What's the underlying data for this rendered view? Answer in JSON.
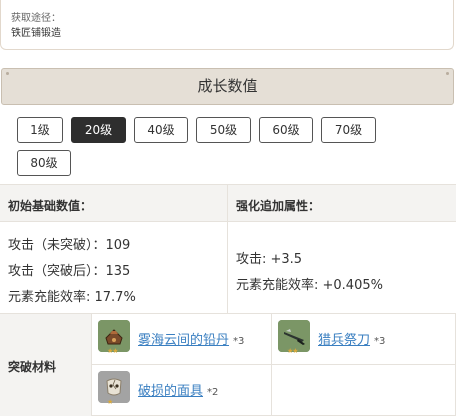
{
  "source": {
    "label": "获取途径：",
    "value": "铁匠铺锻造"
  },
  "growth": {
    "title": "成长数值",
    "levels": [
      "1级",
      "20级",
      "40级",
      "50级",
      "60级",
      "70级",
      "80级"
    ],
    "selected": "20级"
  },
  "stats": {
    "base_header": "初始基础数值：",
    "bonus_header": "强化追加属性：",
    "base": [
      "攻击（未突破）：109",
      "攻击（突破后）：135",
      "元素充能效率: 17.7%"
    ],
    "bonus": [
      "攻击: +3.5",
      "元素充能效率: +0.405%"
    ]
  },
  "materials": {
    "label": "突破材料",
    "items": [
      {
        "name": "雾海云间的铅丹",
        "count": "*3",
        "icon": "lead-elixir-icon"
      },
      {
        "name": "猎兵祭刀",
        "count": "*3",
        "icon": "hunter-sacrificial-knife-icon"
      },
      {
        "name": "破损的面具",
        "count": "*2",
        "icon": "damaged-mask-icon"
      }
    ]
  },
  "colors": {
    "accent_dark": "#2e2e2e",
    "link": "#3a7fc1",
    "header_bg": "#e5dfd6",
    "star": "#d9a93a"
  }
}
